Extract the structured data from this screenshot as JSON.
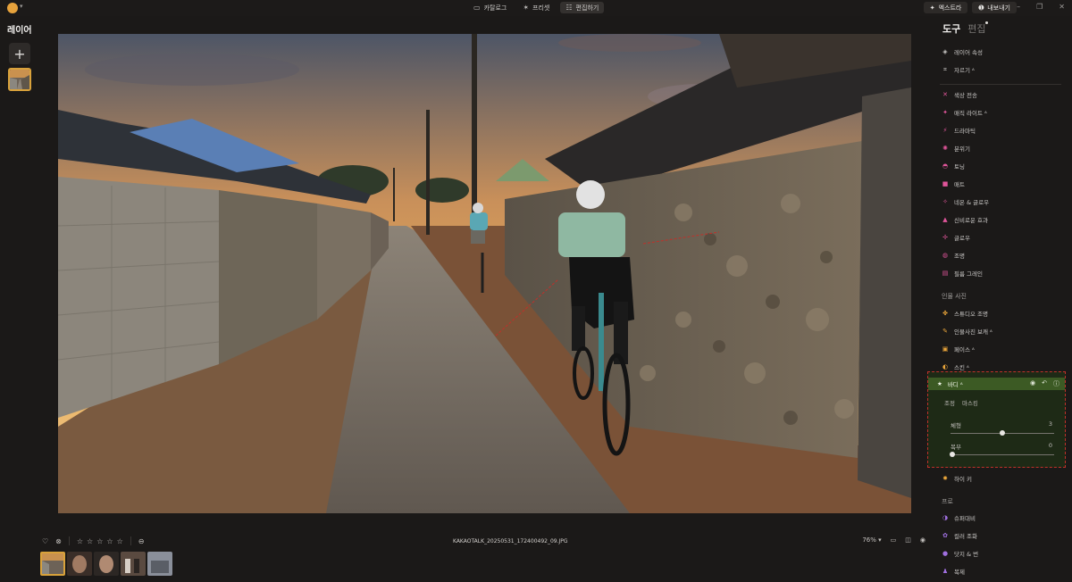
{
  "top": {
    "modes": [
      {
        "label": "카탈로그",
        "icon": "catalog-icon",
        "glyph": "▭"
      },
      {
        "label": "프리셋",
        "icon": "preset-icon",
        "glyph": "✶"
      },
      {
        "label": "편집하기",
        "icon": "edit-icon",
        "glyph": "☷",
        "active": true
      }
    ],
    "extras_label": "엑스트라",
    "export_label": "내보내기"
  },
  "left": {
    "title": "레이어"
  },
  "right": {
    "tab_tools": "도구",
    "tab_edit": "편집",
    "tools_a": [
      {
        "label": "레이어 속성",
        "icon": "layers-icon",
        "glyph": "◈",
        "color": "#cbc9c7"
      },
      {
        "label": "자르기 ᴬ",
        "icon": "crop-icon",
        "glyph": "⌗",
        "color": "#cbc9c7"
      }
    ],
    "tools_b": [
      {
        "label": "색상 전송",
        "icon": "color-transfer-icon",
        "glyph": "✕",
        "color": "#e0559a"
      },
      {
        "label": "매직 라이트 ᴬ",
        "icon": "magic-light-icon",
        "glyph": "✦",
        "color": "#e0559a"
      },
      {
        "label": "드라마틱",
        "icon": "dramatic-icon",
        "glyph": "⚡",
        "color": "#e0559a"
      },
      {
        "label": "분위기",
        "icon": "mood-icon",
        "glyph": "✺",
        "color": "#e0559a"
      },
      {
        "label": "토닝",
        "icon": "toning-icon",
        "glyph": "◓",
        "color": "#e0559a"
      },
      {
        "label": "매트",
        "icon": "matte-icon",
        "glyph": "■",
        "color": "#e0559a"
      },
      {
        "label": "네온 & 글로우",
        "icon": "neon-glow-icon",
        "glyph": "✧",
        "color": "#e0559a"
      },
      {
        "label": "신비로운 효과",
        "icon": "mystical-icon",
        "glyph": "▲",
        "color": "#e0559a"
      },
      {
        "label": "글로우",
        "icon": "glow-icon",
        "glyph": "✢",
        "color": "#e0559a"
      },
      {
        "label": "조명",
        "icon": "lighting-icon",
        "glyph": "◍",
        "color": "#e0559a"
      },
      {
        "label": "필름 그레인",
        "icon": "film-grain-icon",
        "glyph": "▤",
        "color": "#e0559a"
      }
    ],
    "portrait_section": "인물 사진",
    "tools_c": [
      {
        "label": "스튜디오 조명",
        "icon": "studio-light-icon",
        "glyph": "✤",
        "color": "#e8a43a"
      },
      {
        "label": "인물사진 보캐 ᴬ",
        "icon": "portrait-bokeh-icon",
        "glyph": "✎",
        "color": "#e8a43a"
      },
      {
        "label": "페이스 ᴬ",
        "icon": "face-icon",
        "glyph": "▣",
        "color": "#e8a43a"
      },
      {
        "label": "스킨 ᴬ",
        "icon": "skin-icon",
        "glyph": "◐",
        "color": "#e8a43a"
      }
    ],
    "body": {
      "label": "바디 ᴬ",
      "subtab_adjust": "조정",
      "subtab_mask": "마스킹",
      "slider1_label": "체형",
      "slider1_value": "3",
      "slider1_fraction": 0.5,
      "slider2_label": "복부",
      "slider2_value": "0",
      "slider2_fraction": 0.0
    },
    "high_key": "하이 키",
    "pro_section": "프로",
    "tools_d": [
      {
        "label": "슈퍼대비",
        "icon": "supercontrast-icon",
        "glyph": "◑",
        "color": "#a070e0"
      },
      {
        "label": "컬러 조화",
        "icon": "color-harmony-icon",
        "glyph": "✿",
        "color": "#a070e0"
      },
      {
        "label": "닷지 & 번",
        "icon": "dodge-burn-icon",
        "glyph": "●",
        "color": "#a070e0"
      },
      {
        "label": "복제",
        "icon": "clone-icon",
        "glyph": "♟",
        "color": "#a070e0"
      }
    ]
  },
  "bottom": {
    "filename": "KAKAOTALK_20250531_172400492_09.JPG",
    "zoom": "76% ▾",
    "stars": [
      "☆",
      "☆",
      "☆",
      "☆",
      "☆"
    ]
  }
}
